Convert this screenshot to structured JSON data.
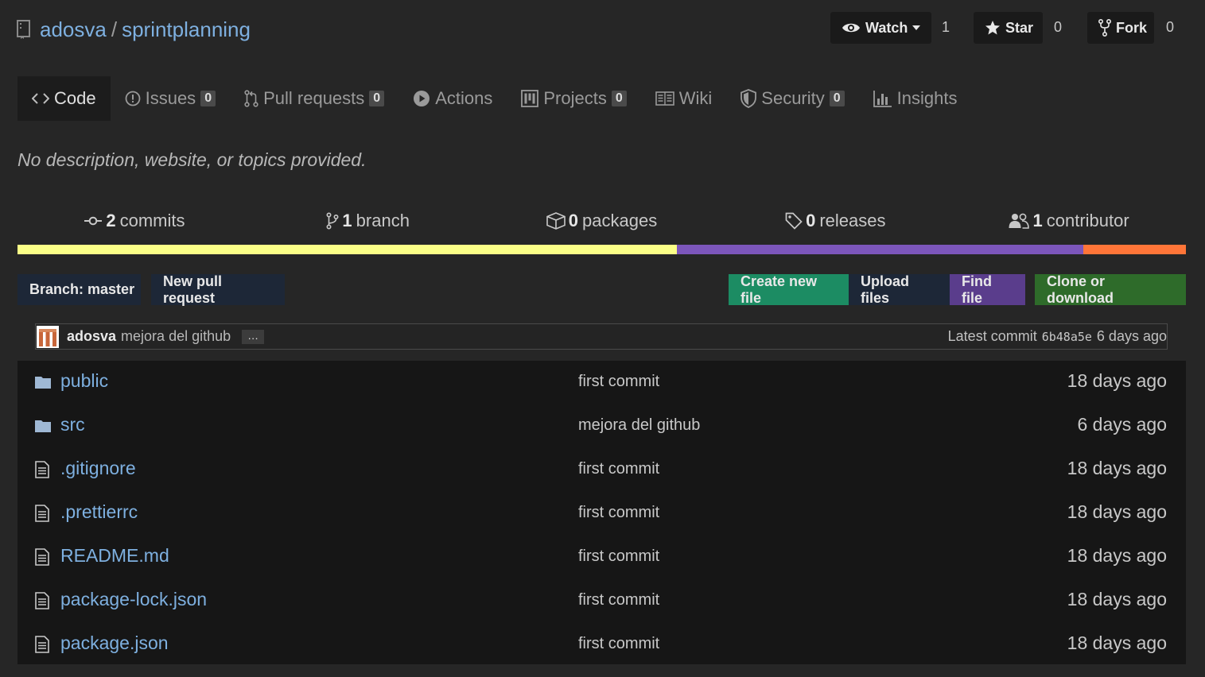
{
  "repo": {
    "owner": "adosva",
    "separator": "/",
    "name": "sprintplanning"
  },
  "header_buttons": {
    "watch": {
      "label": "Watch",
      "count": "1"
    },
    "star": {
      "label": "Star",
      "count": "0"
    },
    "fork": {
      "label": "Fork",
      "count": "0"
    }
  },
  "tabs": [
    {
      "label": "Code",
      "icon": "code-icon"
    },
    {
      "label": "Issues",
      "count": "0",
      "icon": "issue-icon"
    },
    {
      "label": "Pull requests",
      "count": "0",
      "icon": "pull-request-icon"
    },
    {
      "label": "Actions",
      "icon": "play-icon"
    },
    {
      "label": "Projects",
      "count": "0",
      "icon": "project-icon"
    },
    {
      "label": "Wiki",
      "icon": "book-icon"
    },
    {
      "label": "Security",
      "count": "0",
      "icon": "shield-icon"
    },
    {
      "label": "Insights",
      "icon": "graph-icon"
    }
  ],
  "description": "No description, website, or topics provided.",
  "summary": {
    "commits": {
      "num": "2",
      "label": "commits"
    },
    "branches": {
      "num": "1",
      "label": "branch"
    },
    "packages": {
      "num": "0",
      "label": "packages"
    },
    "releases": {
      "num": "0",
      "label": "releases"
    },
    "contributors": {
      "num": "1",
      "label": "contributor"
    }
  },
  "language_bar": [
    {
      "color": "#fbff87",
      "fraction": 0.564
    },
    {
      "color": "#7c56bb",
      "fraction": 0.348
    },
    {
      "color": "#ff7538",
      "fraction": 0.088
    }
  ],
  "toolbar": {
    "branch_prefix": "Branch:",
    "branch_name": "master",
    "new_pull_request": "New pull request",
    "create_new_file": "Create new file",
    "upload_files": "Upload files",
    "find_file": "Find file",
    "clone_or_download": "Clone or download",
    "colors": {
      "create": "#1c8c63",
      "upload": "#1d2737",
      "find": "#5a3d8c",
      "clone": "#2e6b2a",
      "neutral": "#1d2737"
    }
  },
  "latest_commit": {
    "author": "adosva",
    "message": "mejora del github",
    "ellipsis": "…",
    "prefix": "Latest commit",
    "sha": "6b48a5e",
    "age": "6 days ago"
  },
  "files": [
    {
      "name": "public",
      "type": "folder",
      "message": "first commit",
      "age": "18 days ago"
    },
    {
      "name": "src",
      "type": "folder",
      "message": "mejora del github",
      "age": "6 days ago"
    },
    {
      "name": ".gitignore",
      "type": "file",
      "message": "first commit",
      "age": "18 days ago"
    },
    {
      "name": ".prettierrc",
      "type": "file",
      "message": "first commit",
      "age": "18 days ago"
    },
    {
      "name": "README.md",
      "type": "file",
      "message": "first commit",
      "age": "18 days ago"
    },
    {
      "name": "package-lock.json",
      "type": "file",
      "message": "first commit",
      "age": "18 days ago"
    },
    {
      "name": "package.json",
      "type": "file",
      "message": "first commit",
      "age": "18 days ago"
    }
  ]
}
